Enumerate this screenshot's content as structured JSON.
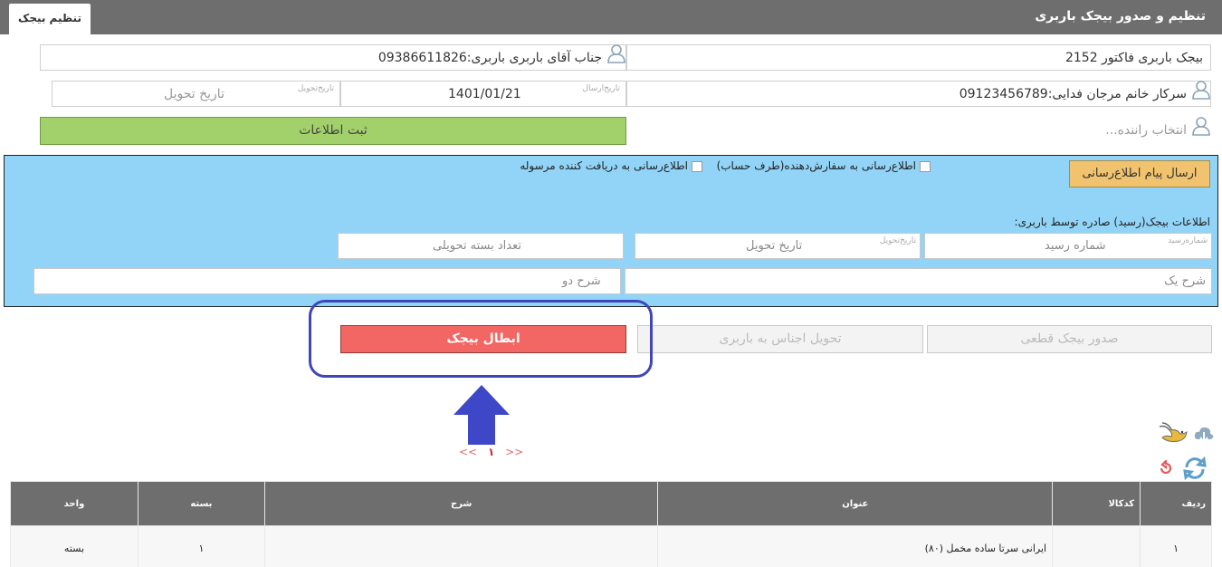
{
  "header": {
    "title": "تنظیم و صدور بیجک باربری",
    "tab_label": "تنظیم بیجک"
  },
  "form": {
    "invoice_field": "بیجک باربری فاکتور 2152",
    "carrier_field": "جناب آقای باربری باربری:09386611826",
    "customer_field": "سرکار خانم مرجان فدایی:09123456789",
    "send_date_label": "تاریخ‌ارسال",
    "send_date_value": "1401/01/21",
    "delivery_date_small": "تاریخ‌تحویل",
    "delivery_date_placeholder": "تاریخ تحویل",
    "driver_placeholder": "انتخاب راننده...",
    "save_button": "ثبت اطلاعات"
  },
  "notify": {
    "button": "ارسال پیام اطلاع‌رسانی",
    "option_sender": "اطلاع‌رسانی به سفارش‌دهنده(طرف حساب)",
    "option_receiver": "اطلاع‌رسانی به دریافت کننده مرسوله",
    "section_label": "اطلاعات بیجک(رسید) صادره توسط باربری:",
    "receipt_small": "شماره‌رسید",
    "receipt_placeholder": "شماره رسید",
    "delivery_small": "تاریخ‌تحویل",
    "delivery_placeholder": "تاریخ تحویل",
    "package_count_placeholder": "تعداد بسته تحویلی",
    "desc_one_placeholder": "شرح یک",
    "desc_two_placeholder": "شرح دو"
  },
  "actions": {
    "final_issue": "صدور بیجک قطعی",
    "deliver_goods": "تحویل اجناس به باربری",
    "cancel_invoice": "ابطال بیجک"
  },
  "pager": {
    "prev": "<<",
    "current": "۱",
    "next": ">>"
  },
  "table": {
    "columns": [
      "ردیف",
      "کدکالا",
      "عنوان",
      "شرح",
      "بسته",
      "واحد"
    ],
    "rows": [
      {
        "row": "۱",
        "code": "",
        "title": "ایرانی سرتا ساده مخمل (۸۰)",
        "desc": "",
        "package": "۱",
        "unit": "بسته"
      }
    ]
  },
  "colors": {
    "header_bg": "#6f6e6e",
    "panel_blue": "#92d4f7",
    "save_green": "#a2d06a",
    "cancel_red": "#f26763",
    "notify_orange": "#f1c36e",
    "highlight_blue": "#3f47b8"
  }
}
